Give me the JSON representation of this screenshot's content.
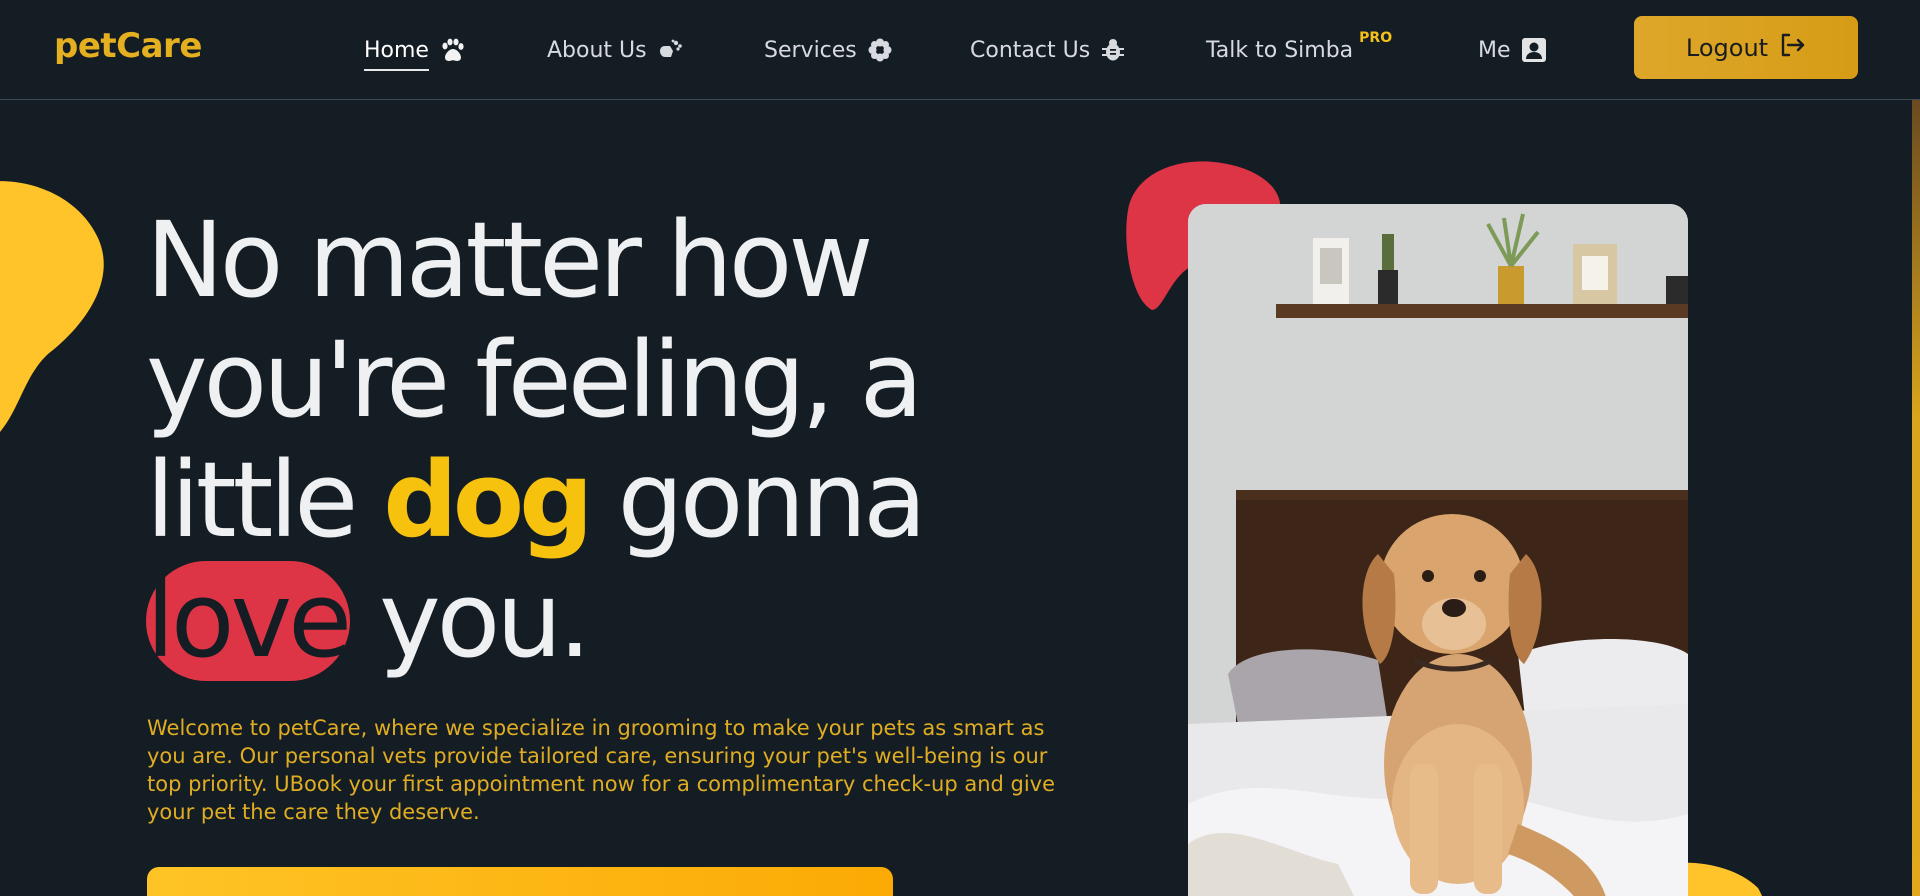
{
  "brand": {
    "logo_text": "petCare",
    "accent": "#e5b01f",
    "red": "#dd3545",
    "background": "#151d24"
  },
  "nav": {
    "items": [
      {
        "label": "Home",
        "icon": "paw-icon",
        "active": true
      },
      {
        "label": "About Us",
        "icon": "dog-bone-icon",
        "active": false
      },
      {
        "label": "Services",
        "icon": "flower-icon",
        "active": false
      },
      {
        "label": "Contact Us",
        "icon": "bug-icon",
        "active": false
      },
      {
        "label": "Talk to Simba",
        "badge": "PRO",
        "active": false
      },
      {
        "label": "Me",
        "icon": "user-portrait-icon",
        "active": false
      }
    ],
    "logout_label": "Logout",
    "logout_icon": "logout-arrow-icon"
  },
  "hero": {
    "line1": "No matter how",
    "line2": "you're feeling, a",
    "line3_pre": "little ",
    "line3_highlight": "dog",
    "line3_post": " gonna",
    "line4_highlight": "love",
    "line4_post": " you.",
    "intro": "Welcome to petCare, where we specialize in grooming to make your pets as smart as you are. Our personal vets provide tailored care, ensuring your pet's well-being is our top priority. UBook your first appointment now for a complimentary check-up and give your pet the care they deserve.",
    "image_subject": "golden retriever puppy sitting on a bed"
  }
}
